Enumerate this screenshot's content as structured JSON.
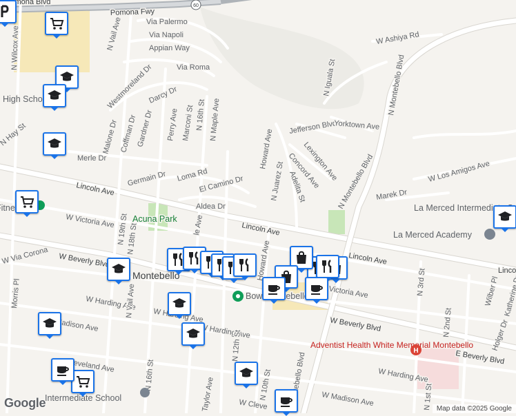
{
  "map": {
    "attribution": "Map data ©2025 Google",
    "logo_text": "Google",
    "freeway_label": "Pomona Fwy",
    "freeway_shield": "60",
    "colors": {
      "land": "#f5f3ef",
      "road": "#ffffff",
      "freeway": "#9aa0a6",
      "park": "#c8e6b8",
      "hospital_area": "#f6dcdc",
      "school_area": "#f6e8b8",
      "pin_border": "#1a73e8"
    }
  },
  "street_labels": [
    "Pomona Blvd",
    "Via Palermo",
    "Via Napoli",
    "Appian Way",
    "Via Roma",
    "N Vail Ave",
    "N Wilcox Ave",
    "Westmoreland Dr",
    "Darcy Dr",
    "Perry Ave",
    "Marconi St",
    "N 16th St",
    "N Maple Ave",
    "Malone Dr",
    "Coffman Dr",
    "Gardner Dr",
    "N Hay St",
    "Merle Dr",
    "Germain Dr",
    "Loma Rd",
    "El Camino Dr",
    "Aldea Dr",
    "Lincoln Ave",
    "Lincoln Ave",
    "Lincoln Ave",
    "Linco",
    "W Victoria Ave",
    "W Victoria Ave",
    "N 19th St",
    "N 18th St",
    "W Via Corona",
    "Morris Pl",
    "W Beverly Blvd",
    "W Beverly Blvd",
    "E Beverly Blvd",
    "W Harding Ave",
    "W Harding Ave",
    "W Harding Ave",
    "W Harding Ave",
    "N Vail Ave",
    "N 16th St",
    "N 12th St",
    "Taylor Ave",
    "Cleveland Ave",
    "N 10th St",
    "W Madison Ave",
    "Madison Ave",
    "W Cleve",
    "Howard Ave",
    "Howard Ave",
    "N Juarez St",
    "Adelita St",
    "Concord Ave",
    "Lexington Ave",
    "Jefferson Blvd",
    "Yorktown Ave",
    "N Iguala St",
    "W Ashiya Rd",
    "N Montebello Blvd",
    "N Montebello Blvd",
    "N Montebello Blvd",
    "W Los Amigos Ave",
    "Marek Dr",
    "N 3rd St",
    "N 1st St",
    "N 2nd St",
    "Wilber Pl",
    "Katherine Dr",
    "Holger Dr",
    "le Ave"
  ],
  "place_labels": {
    "city": "Montebello",
    "park": "Acuna Park",
    "school_1": "La Merced Intermediate School",
    "school_2": "La Merced Academy",
    "hospital": "Adventist Health White Memorial Montebello",
    "high_school": "High School",
    "fitness": "Fitness",
    "intermediate": "Intermediate School",
    "bowl": "Bowl Montebello"
  },
  "pins": [
    {
      "icon": "school-icon"
    },
    {
      "icon": "school-icon"
    },
    {
      "icon": "school-icon"
    },
    {
      "icon": "shopping-cart-icon"
    },
    {
      "icon": "school-icon"
    },
    {
      "icon": "school-icon"
    },
    {
      "icon": "school-icon"
    },
    {
      "icon": "school-icon"
    },
    {
      "icon": "school-icon"
    },
    {
      "icon": "school-icon"
    },
    {
      "icon": "shopping-cart-icon"
    },
    {
      "icon": "shopping-cart-icon"
    },
    {
      "icon": "restaurant-icon"
    },
    {
      "icon": "restaurant-icon"
    },
    {
      "icon": "restaurant-icon"
    },
    {
      "icon": "restaurant-icon"
    },
    {
      "icon": "restaurant-icon"
    },
    {
      "icon": "restaurant-icon"
    },
    {
      "icon": "restaurant-icon"
    },
    {
      "icon": "shopping-bag-icon"
    },
    {
      "icon": "shopping-bag-icon"
    },
    {
      "icon": "shopping-bag-icon"
    },
    {
      "icon": "restaurant-icon"
    },
    {
      "icon": "cafe-icon"
    },
    {
      "icon": "cafe-icon"
    },
    {
      "icon": "cafe-icon"
    },
    {
      "icon": "cafe-icon"
    },
    {
      "icon": "parking-icon"
    }
  ]
}
